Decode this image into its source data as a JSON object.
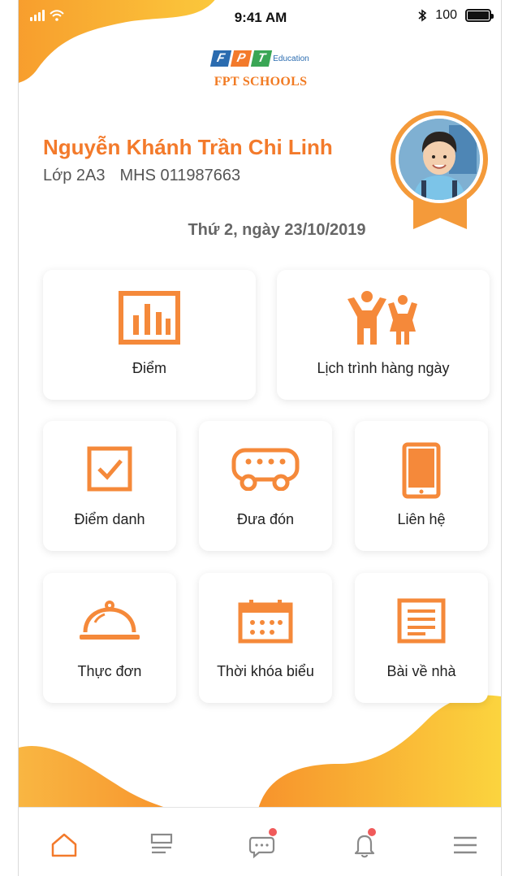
{
  "status_bar": {
    "time": "9:41 AM",
    "battery": "100",
    "battery_level": 1.0
  },
  "header": {
    "brand": "FPT",
    "brand_letters": [
      "F",
      "P",
      "T"
    ],
    "edu_label": "Education",
    "school": "FPT SCHOOLS"
  },
  "student": {
    "name": "Nguyễn Khánh Trần Chi Linh",
    "class": "Lớp 2A3",
    "id": "MHS 011987663"
  },
  "date": "Thứ 2, ngày 23/10/2019",
  "tiles": [
    {
      "label": "Điểm",
      "icon": "bar-chart-icon"
    },
    {
      "label": "Lịch trình hàng ngày",
      "icon": "children-icon"
    },
    {
      "label": "Điểm danh",
      "icon": "checkbox-icon"
    },
    {
      "label": "Đưa đón",
      "icon": "bus-icon"
    },
    {
      "label": "Liên hệ",
      "icon": "phone-icon"
    },
    {
      "label": "Thực đơn",
      "icon": "food-cloche-icon"
    },
    {
      "label": "Thời khóa biểu",
      "icon": "calendar-icon"
    },
    {
      "label": "Bài về nhà",
      "icon": "document-icon"
    }
  ],
  "nav": [
    {
      "icon": "home-icon",
      "active": true
    },
    {
      "icon": "list-icon",
      "active": false
    },
    {
      "icon": "chat-icon",
      "active": false,
      "badge": true
    },
    {
      "icon": "bell-icon",
      "active": false,
      "badge": true
    },
    {
      "icon": "menu-icon",
      "active": false
    }
  ],
  "colors": {
    "accent": "#f37a2b",
    "accent_light": "#f9b642",
    "badge": "#f05a5a",
    "nav_inactive": "#8a8a8a"
  }
}
